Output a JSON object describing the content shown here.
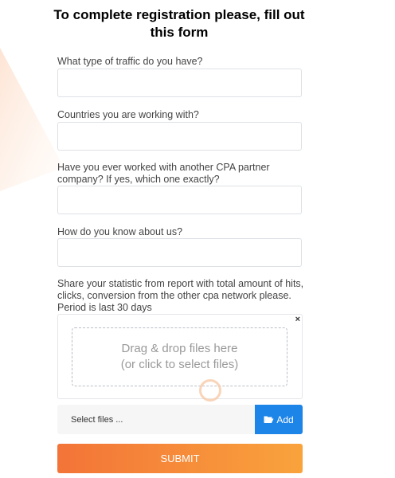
{
  "form": {
    "title": "To complete registration please, fill out this form",
    "fields": [
      {
        "label": "What type of traffic do you have?",
        "value": "",
        "placeholder": ""
      },
      {
        "label": "Countries you are working with?",
        "value": "",
        "placeholder": ""
      },
      {
        "label": "Have you ever worked with another CPA partner company? If yes, which one exactly?",
        "value": "",
        "placeholder": ""
      },
      {
        "label": "How do you know about us?",
        "value": "",
        "placeholder": ""
      }
    ],
    "upload": {
      "label": "Share your statistic from report with total amount of hits, clicks, conversion from the other cpa network please. Period is last 30 days",
      "drop_line1": "Drag & drop files here",
      "drop_line2": "(or click to select files)",
      "close_glyph": "×",
      "file_placeholder": "Select files ...",
      "add_label": "Add"
    },
    "submit_label": "SUBMIT"
  },
  "colors": {
    "accent_orange_start": "#f37438",
    "accent_orange_end": "#f9a33c",
    "add_button_blue": "#1d84e8"
  },
  "icons": {
    "add": "folder-open-icon",
    "remove": "close-icon"
  }
}
